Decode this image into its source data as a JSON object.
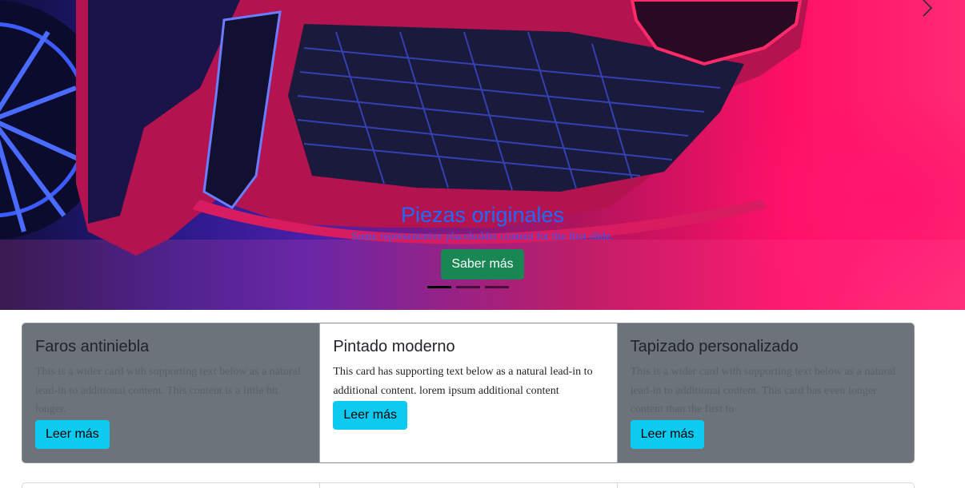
{
  "carousel": {
    "heading": "Piezas originales",
    "text": "Some representative placeholder content for the first slide.",
    "button": "Saber más",
    "indicator_count": 3,
    "active_indicator": 0,
    "next_icon": "chevron-right-icon"
  },
  "cards": [
    {
      "title": "Faros antiniebla",
      "text": "This is a wider card with supporting text below as a natural lead-in to additional content. This content is a little bit longer.",
      "button": "Leer más"
    },
    {
      "title": "Pintado moderno",
      "text": "This card has supporting text below as a natural lead-in to additional content. lorem ipsum additional content",
      "button": "Leer más"
    },
    {
      "title": "Tapizado personalizado",
      "text": "This is a wider card with supporting text below as a natural lead-in to additional content. This card has even longer content than the first to",
      "button": "Leer más"
    }
  ],
  "colors": {
    "heading": "#1a6cff",
    "primary_button": "#198754",
    "info_button": "#0dcaf0",
    "dark_card": "#6c737b"
  }
}
